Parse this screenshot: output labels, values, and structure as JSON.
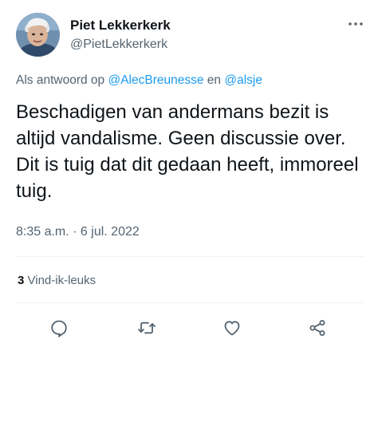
{
  "author": {
    "name": "Piet Lekkerkerk",
    "handle": "@PietLekkerkerk"
  },
  "reply": {
    "prefix": "Als antwoord op",
    "mention1": "@AlecBreunesse",
    "joiner": "en",
    "mention2": "@alsje"
  },
  "tweet": {
    "text": "Beschadigen van andermans bezit is altijd vandalisme. Geen discussie over. Dit is tuig dat dit gedaan heeft, immoreel tuig."
  },
  "meta": {
    "timestamp": "8:35 a.m. · 6 jul. 2022"
  },
  "stats": {
    "likes_count": "3",
    "likes_label": "Vind-ik-leuks"
  },
  "icons": {
    "more": "more-options-icon",
    "reply": "reply-icon",
    "retweet": "retweet-icon",
    "like": "like-icon",
    "share": "share-icon"
  },
  "colors": {
    "text": "#0f1419",
    "secondary": "#536471",
    "link": "#1d9bf0",
    "divider": "#eff3f4"
  }
}
